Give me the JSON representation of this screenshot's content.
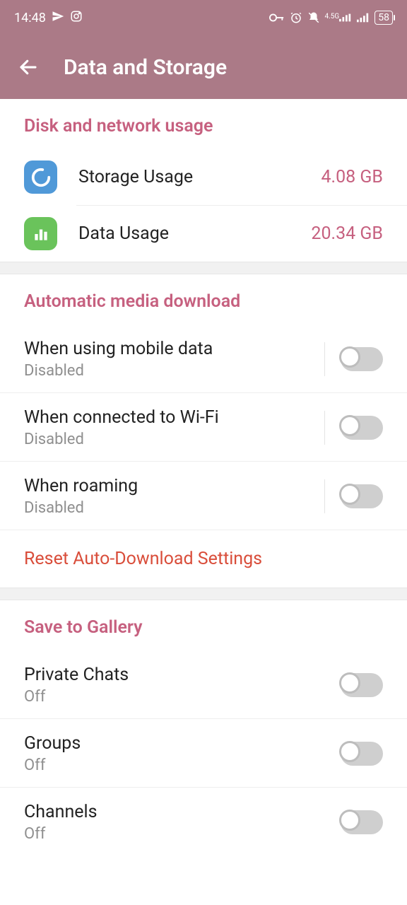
{
  "status": {
    "time": "14:48",
    "battery": "58"
  },
  "header": {
    "title": "Data and Storage"
  },
  "sections": {
    "disk": {
      "header": "Disk and network usage",
      "storage": {
        "label": "Storage Usage",
        "value": "4.08 GB"
      },
      "data": {
        "label": "Data Usage",
        "value": "20.34 GB"
      }
    },
    "auto": {
      "header": "Automatic media download",
      "mobile": {
        "title": "When using mobile data",
        "sub": "Disabled"
      },
      "wifi": {
        "title": "When connected to Wi-Fi",
        "sub": "Disabled"
      },
      "roaming": {
        "title": "When roaming",
        "sub": "Disabled"
      },
      "reset": "Reset Auto-Download Settings"
    },
    "gallery": {
      "header": "Save to Gallery",
      "private": {
        "title": "Private Chats",
        "sub": "Off"
      },
      "groups": {
        "title": "Groups",
        "sub": "Off"
      },
      "channels": {
        "title": "Channels",
        "sub": "Off"
      }
    }
  }
}
